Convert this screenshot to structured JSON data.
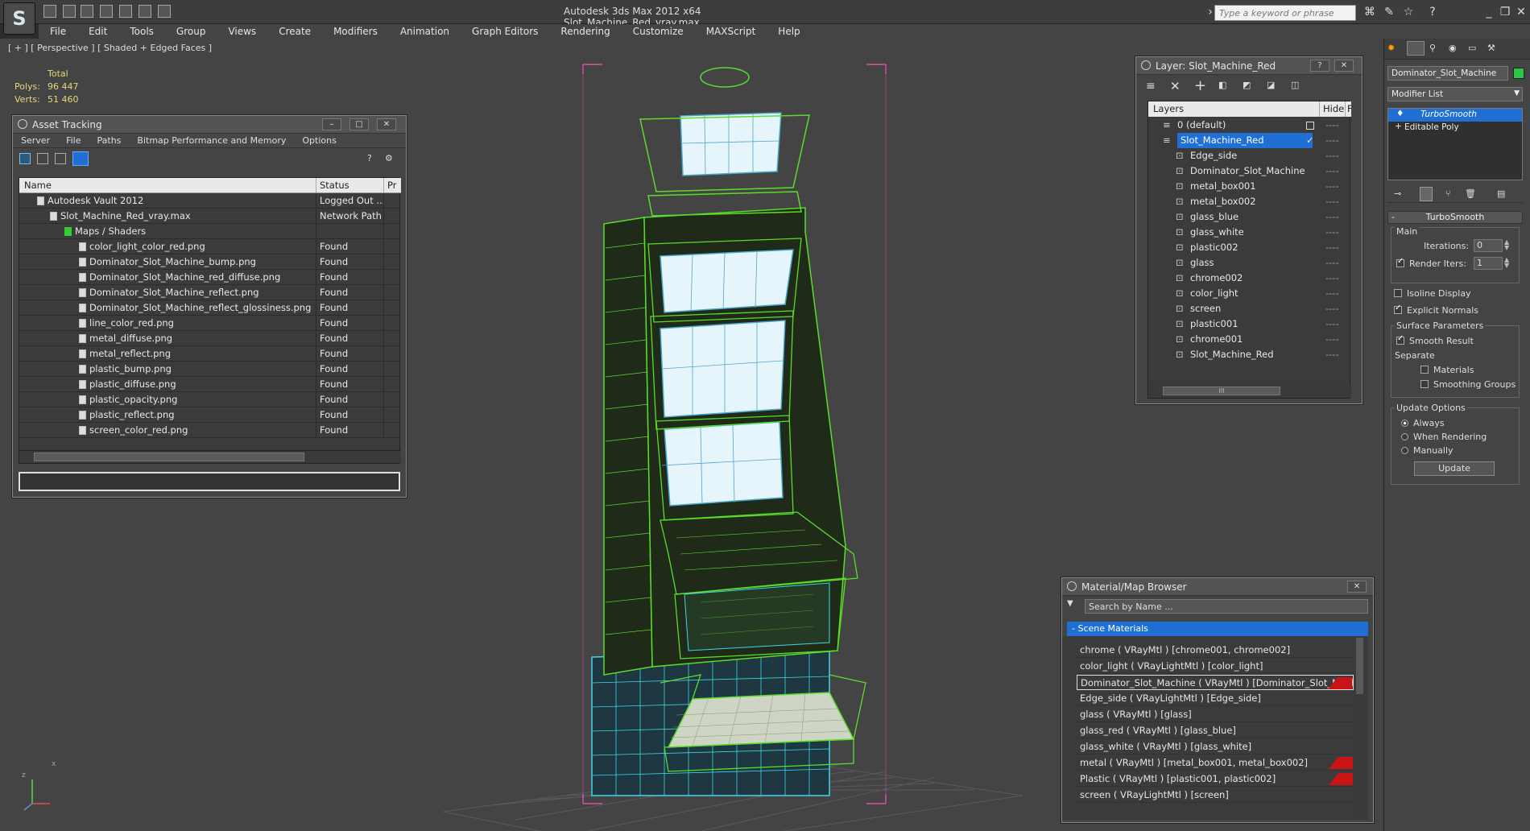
{
  "app": {
    "logo_glyph": "S",
    "title": "Autodesk 3ds Max  2012 x64     Slot_Machine_Red_vray.max",
    "search_placeholder": "Type a keyword or phrase"
  },
  "menu": [
    "File",
    "Edit",
    "Tools",
    "Group",
    "Views",
    "Create",
    "Modifiers",
    "Animation",
    "Graph Editors",
    "Rendering",
    "Customize",
    "MAXScript",
    "Help"
  ],
  "viewport": {
    "label": "[ + ] [ Perspective ] [ Shaded + Edged Faces ]",
    "stats": {
      "total_label": "Total",
      "polys_label": "Polys:",
      "polys_value": "96 447",
      "verts_label": "Verts:",
      "verts_value": "51 460"
    },
    "axis": {
      "y": "y",
      "x": "x",
      "z": "z"
    }
  },
  "asset_tracking": {
    "title": "Asset Tracking",
    "menu": [
      "Server",
      "File",
      "Paths",
      "Bitmap Performance and Memory",
      "Options"
    ],
    "columns": {
      "name": "Name",
      "status": "Status",
      "pr": "Pr"
    },
    "rows": [
      {
        "name": "Autodesk Vault 2012",
        "status": "Logged Out ..."
      },
      {
        "name": "Slot_Machine_Red_vray.max",
        "status": "Network Path"
      },
      {
        "name": "Maps / Shaders",
        "status": ""
      },
      {
        "name": "color_light_color_red.png",
        "status": "Found"
      },
      {
        "name": "Dominator_Slot_Machine_bump.png",
        "status": "Found"
      },
      {
        "name": "Dominator_Slot_Machine_red_diffuse.png",
        "status": "Found"
      },
      {
        "name": "Dominator_Slot_Machine_reflect.png",
        "status": "Found"
      },
      {
        "name": "Dominator_Slot_Machine_reflect_glossiness.png",
        "status": "Found"
      },
      {
        "name": "line_color_red.png",
        "status": "Found"
      },
      {
        "name": "metal_diffuse.png",
        "status": "Found"
      },
      {
        "name": "metal_reflect.png",
        "status": "Found"
      },
      {
        "name": "plastic_bump.png",
        "status": "Found"
      },
      {
        "name": "plastic_diffuse.png",
        "status": "Found"
      },
      {
        "name": "plastic_opacity.png",
        "status": "Found"
      },
      {
        "name": "plastic_reflect.png",
        "status": "Found"
      },
      {
        "name": "screen_color_red.png",
        "status": "Found"
      }
    ]
  },
  "layer_panel": {
    "title": "Layer: Slot_Machine_Red",
    "col_layers": "Layers",
    "col_hide": "Hide",
    "col_f": "F",
    "rows": [
      "0 (default)",
      "Slot_Machine_Red",
      "Edge_side",
      "Dominator_Slot_Machine",
      "metal_box001",
      "metal_box002",
      "glass_blue",
      "glass_white",
      "plastic002",
      "glass",
      "chrome002",
      "color_light",
      "screen",
      "plastic001",
      "chrome001",
      "Slot_Machine_Red"
    ],
    "scroll_glyph": "III"
  },
  "material_browser": {
    "title": "Material/Map Browser",
    "search_placeholder": "Search by Name ...",
    "group": "- Scene Materials",
    "rows": [
      {
        "text": "chrome  ( VRayMtl ) [chrome001, chrome002]",
        "swatch": false,
        "selected": false
      },
      {
        "text": "color_light  ( VRayLightMtl ) [color_light]",
        "swatch": false,
        "selected": false
      },
      {
        "text": "Dominator_Slot_Machine  ( VRayMtl ) [Dominator_Slot_Machine]",
        "swatch": true,
        "selected": true
      },
      {
        "text": "Edge_side  ( VRayLightMtl ) [Edge_side]",
        "swatch": false,
        "selected": false
      },
      {
        "text": "glass  ( VRayMtl ) [glass]",
        "swatch": false,
        "selected": false
      },
      {
        "text": "glass_red  ( VRayMtl ) [glass_blue]",
        "swatch": false,
        "selected": false
      },
      {
        "text": "glass_white  ( VRayMtl ) [glass_white]",
        "swatch": false,
        "selected": false
      },
      {
        "text": "metal  ( VRayMtl ) [metal_box001, metal_box002]",
        "swatch": true,
        "selected": false
      },
      {
        "text": "Plastic  ( VRayMtl ) [plastic001, plastic002]",
        "swatch": true,
        "selected": false
      },
      {
        "text": "screen  ( VRayLightMtl ) [screen]",
        "swatch": false,
        "selected": false
      }
    ]
  },
  "command_panel": {
    "object_name": "Dominator_Slot_Machine",
    "modifier_list": "Modifier List",
    "stack": [
      "TurboSmooth",
      "Editable Poly"
    ],
    "rollout_title": "TurboSmooth",
    "main": "Main",
    "iterations_label": "Iterations:",
    "iterations_value": "0",
    "render_iters_label": "Render Iters:",
    "render_iters_value": "1",
    "isoline": "Isoline Display",
    "explicit": "Explicit Normals",
    "surface": "Surface Parameters",
    "smooth": "Smooth Result",
    "separate": "Separate",
    "materials": "Materials",
    "smoothing": "Smoothing Groups",
    "update_options": "Update Options",
    "always": "Always",
    "when_rendering": "When Rendering",
    "manually": "Manually",
    "update_button": "Update"
  },
  "colors": {
    "accent": "#1f6fd4",
    "viewport_bg": "#444444",
    "wire_green": "#5adc2a",
    "wire_cyan": "#3ed8e6",
    "selection_box": "#ff4fc0",
    "swatch_red": "#c81414"
  }
}
